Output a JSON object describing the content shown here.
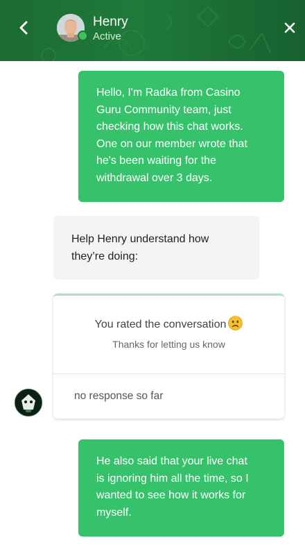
{
  "header": {
    "agent_name": "Henry",
    "agent_status": "Active",
    "status_color": "#3ec45d"
  },
  "messages": [
    {
      "sender": "user",
      "lines": [
        "Hello, I'm Radka from Casino",
        "Guru Community team, just",
        "checking how this chat works.",
        "One on our member wrote that",
        "he's been waiting for the",
        "withdrawal over 3 days."
      ]
    },
    {
      "sender": "bot",
      "lines": [
        "Help Henry understand how",
        "they’re doing:"
      ]
    },
    {
      "sender": "user",
      "lines": [
        "He also said that your live chat",
        "is ignoring him all the time, so I",
        "wanted to see how it works for",
        "myself."
      ]
    }
  ],
  "rating_card": {
    "title": "You rated the conversation",
    "emoji": "slightly-frowning-face",
    "subtitle": "Thanks for letting us know",
    "response": "no response so far"
  },
  "colors": {
    "user_bubble": "#35c26b",
    "bot_bubble": "#f4f4f4",
    "header": "#1f7a3a"
  }
}
